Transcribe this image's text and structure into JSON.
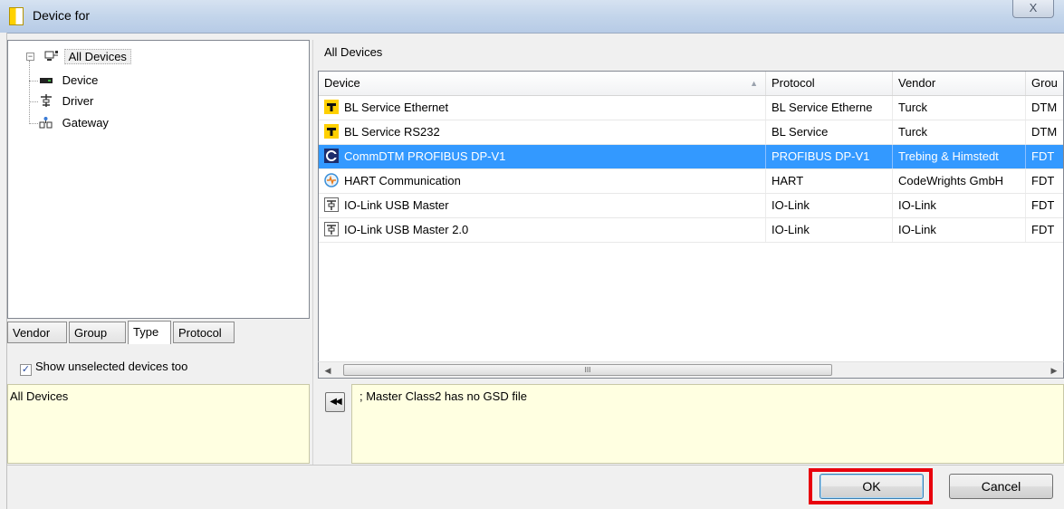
{
  "window": {
    "title": "Device for",
    "close_label": "X"
  },
  "tree": {
    "root": "All Devices",
    "children": [
      "Device",
      "Driver",
      "Gateway"
    ]
  },
  "tabs": [
    "Vendor",
    "Group",
    "Type",
    "Protocol"
  ],
  "active_tab": "Type",
  "show_unselected": {
    "label": "Show unselected devices too",
    "checked": true
  },
  "info_left": "All Devices",
  "list": {
    "caption": "All Devices",
    "columns": [
      "Device",
      "Protocol",
      "Vendor",
      "Grou"
    ],
    "rows": [
      {
        "device": "BL Service Ethernet",
        "protocol": "BL Service Etherne",
        "vendor": "Turck",
        "group": "DTM",
        "icon": "turck-icon"
      },
      {
        "device": "BL Service RS232",
        "protocol": "BL Service",
        "vendor": "Turck",
        "group": "DTM",
        "icon": "turck-icon"
      },
      {
        "device": "CommDTM PROFIBUS DP-V1",
        "protocol": "PROFIBUS DP-V1",
        "vendor": "Trebing & Himstedt",
        "group": "FDT",
        "icon": "commdtm-icon",
        "selected": true
      },
      {
        "device": "HART Communication",
        "protocol": "HART",
        "vendor": "CodeWrights GmbH",
        "group": "FDT",
        "icon": "hart-icon"
      },
      {
        "device": "IO-Link USB Master",
        "protocol": "IO-Link",
        "vendor": "IO-Link",
        "group": "FDT",
        "icon": "driver-icon"
      },
      {
        "device": "IO-Link USB Master 2.0",
        "protocol": "IO-Link",
        "vendor": "IO-Link",
        "group": "FDT",
        "icon": "driver-icon"
      }
    ],
    "scroll_thumb_label": "III"
  },
  "info_right": "; Master Class2 has no GSD file",
  "buttons": {
    "collapse": "◀◀",
    "ok": "OK",
    "cancel": "Cancel"
  },
  "colors": {
    "selection": "#3399ff",
    "info_background": "#ffffe1",
    "highlight": "#e8000d"
  }
}
